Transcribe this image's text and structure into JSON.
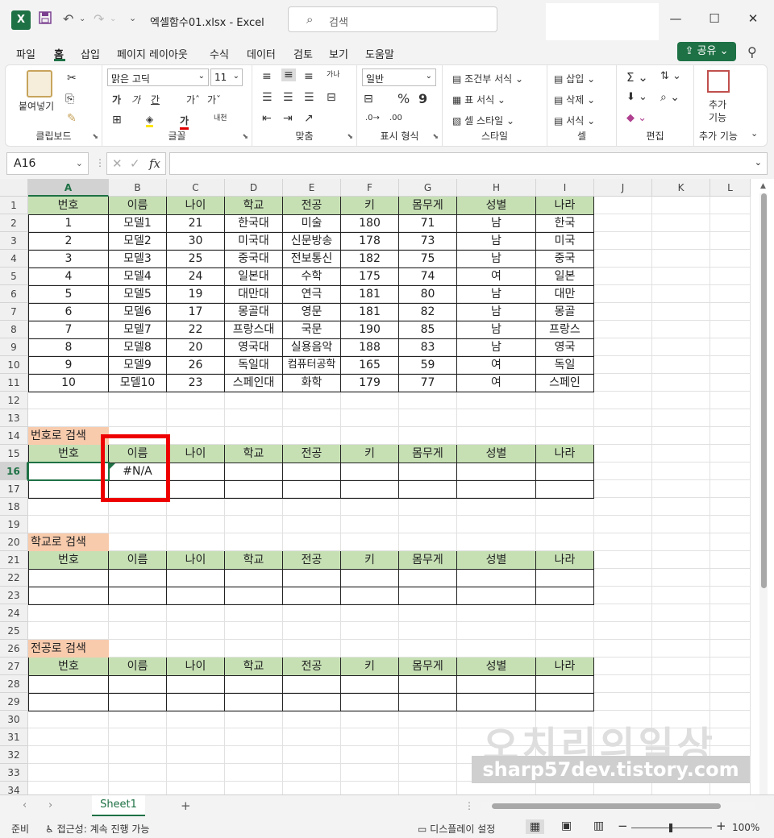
{
  "titlebar": {
    "app_icon": "X",
    "save_icon": "💾",
    "undo_icon": "↶",
    "redo_icon": "↷",
    "more_icon": "⌄",
    "filename": "엑셀함수01.xlsx",
    "sep": "-",
    "app": "Excel",
    "search_placeholder": "검색",
    "minimize": "—",
    "maximize": "☐",
    "close": "✕"
  },
  "menu": {
    "items": [
      "파일",
      "홈",
      "삽입",
      "페이지 레이아웃",
      "수식",
      "데이터",
      "검토",
      "보기",
      "도움말"
    ],
    "share": "공유"
  },
  "ribbon": {
    "clipboard": {
      "paste": "붙여넣기",
      "label": "클립보드"
    },
    "font": {
      "name": "맑은 고딕",
      "size": "11",
      "label": "글꼴",
      "bold": "가",
      "italic": "가",
      "underline": "간",
      "grow": "가ˆ",
      "shrink": "가ˇ",
      "color": "가",
      "phonetic": "내천"
    },
    "align": {
      "label": "맞춤",
      "wrap": "가나"
    },
    "number": {
      "format": "일반",
      "label": "표시 형식",
      "percent": "%",
      "comma": "9"
    },
    "styles": {
      "conditional": "조건부 서식",
      "table": "표 서식",
      "cell": "셀 스타일",
      "label": "스타일"
    },
    "cells": {
      "insert": "삽입",
      "delete": "삭제",
      "format": "서식",
      "label": "셀"
    },
    "editing": {
      "label": "편집"
    },
    "addins": {
      "line1": "추가",
      "line2": "기능",
      "label": "추가 기능"
    }
  },
  "formula_bar": {
    "name_box": "A16",
    "fx": "fx",
    "cancel": "✕",
    "enter": "✓",
    "formula": ""
  },
  "columns": [
    "A",
    "B",
    "C",
    "D",
    "E",
    "F",
    "G",
    "H",
    "I",
    "J",
    "K",
    "L"
  ],
  "rows": [
    "1",
    "2",
    "3",
    "4",
    "5",
    "6",
    "7",
    "8",
    "9",
    "10",
    "11",
    "12",
    "13",
    "14",
    "15",
    "16",
    "17",
    "18",
    "19",
    "20",
    "21",
    "22",
    "23",
    "24",
    "25",
    "26",
    "27",
    "28",
    "29",
    "30",
    "31",
    "32",
    "33",
    "34"
  ],
  "table": {
    "headers": [
      "번호",
      "이름",
      "나이",
      "학교",
      "전공",
      "키",
      "몸무게",
      "성별",
      "나라"
    ],
    "rows": [
      [
        "1",
        "모델1",
        "21",
        "한국대",
        "미술",
        "180",
        "71",
        "남",
        "한국"
      ],
      [
        "2",
        "모델2",
        "30",
        "미국대",
        "신문방송",
        "178",
        "73",
        "남",
        "미국"
      ],
      [
        "3",
        "모델3",
        "25",
        "중국대",
        "전보통신",
        "182",
        "75",
        "남",
        "중국"
      ],
      [
        "4",
        "모델4",
        "24",
        "일본대",
        "수학",
        "175",
        "74",
        "여",
        "일본"
      ],
      [
        "5",
        "모델5",
        "19",
        "대만대",
        "연극",
        "181",
        "80",
        "남",
        "대만"
      ],
      [
        "6",
        "모델6",
        "17",
        "몽골대",
        "영문",
        "181",
        "82",
        "남",
        "몽골"
      ],
      [
        "7",
        "모델7",
        "22",
        "프랑스대",
        "국문",
        "190",
        "85",
        "남",
        "프랑스"
      ],
      [
        "8",
        "모델8",
        "20",
        "영국대",
        "실용음악",
        "188",
        "83",
        "남",
        "영국"
      ],
      [
        "9",
        "모델9",
        "26",
        "독일대",
        "컴퓨터공학",
        "165",
        "59",
        "여",
        "독일"
      ],
      [
        "10",
        "모델10",
        "23",
        "스페인대",
        "화학",
        "179",
        "77",
        "여",
        "스페인"
      ]
    ]
  },
  "search_sections": [
    {
      "title": "번호로 검색",
      "result": [
        "",
        "#N/A",
        "",
        "",
        "",
        "",
        "",
        "",
        ""
      ]
    },
    {
      "title": "학교로 검색",
      "result": [
        "",
        "",
        "",
        "",
        "",
        "",
        "",
        "",
        ""
      ]
    },
    {
      "title": "전공로 검색",
      "result": [
        "",
        "",
        "",
        "",
        "",
        "",
        "",
        "",
        ""
      ]
    }
  ],
  "watermark": {
    "line1": "오치리의일상",
    "line2": "sharp57dev.tistory.com"
  },
  "sheetbar": {
    "tab": "Sheet1",
    "add": "+",
    "prev": "‹",
    "next": "›"
  },
  "status": {
    "ready": "준비",
    "accessibility": "접근성: 계속 진행 가능",
    "display": "디스플레이 설정",
    "zoom": "100%",
    "minus": "−",
    "plus": "+"
  },
  "colors": {
    "accent": "#1e7145",
    "header_fill": "#c6e0b4",
    "section_fill": "#f8cbad",
    "highlight": "#ee0000"
  }
}
